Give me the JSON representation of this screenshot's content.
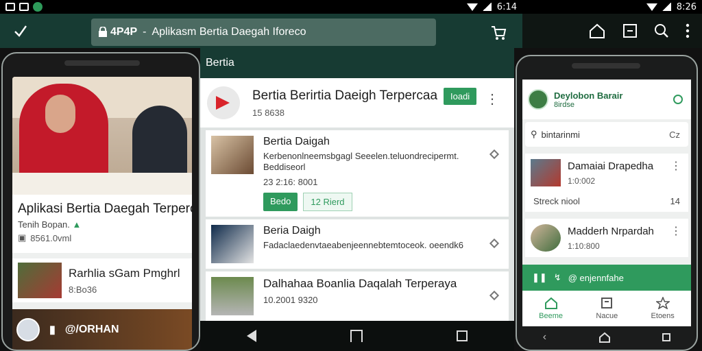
{
  "status": {
    "left_time": "6:14",
    "right_time": "8:26"
  },
  "topbar": {
    "url_tag": "4P4P",
    "url_text": "Aplikasm Bertia Daegah Iforeco"
  },
  "left_phone": {
    "headline": "Aplikasi Bertia Daegah Terperca",
    "source": "Tenih Bopan.",
    "meta": "8561.0vml",
    "card": {
      "title": "Rarhlia sGam Pmghrl",
      "meta": "8:Bo36"
    },
    "footer_label": "@/ORHAN"
  },
  "middle": {
    "section_title": "Bertia",
    "top_item": {
      "title": "Bertia Berirtia Daeigh Terpercaa",
      "sub": "15 8638",
      "badge": "Ioadi"
    },
    "cards": [
      {
        "title": "Bertia Daigah",
        "desc": "Kerbenonlneemsbgagl Seeelen.teluondrecipermt. Beddiseorl",
        "time": "23 2:16: 8001",
        "btn_primary": "Bedo",
        "btn_secondary": "12 Rierd"
      },
      {
        "title": "Beria Daigh",
        "desc": "Fadaclaedenvtaeabenjeennebtemtoceok. oeendk6",
        "time": ""
      },
      {
        "title": "Dalhahaa Boanlia Daqalah Terperaya",
        "desc": "",
        "time": "10.2001 9320"
      }
    ]
  },
  "right_phone": {
    "profile": {
      "name": "Deylobon Barair",
      "sub": "8irdse"
    },
    "search_placeholder": "bintarinmi",
    "search_right": "Cz",
    "cards": [
      {
        "title": "Damaiai Drapedha",
        "meta": "1:0:002",
        "line_left": "Streck niool",
        "line_right": "14"
      },
      {
        "title": "Madderh Nrpardah",
        "meta": "1:10:800"
      }
    ],
    "action_text": "@ enjennfahe",
    "tabs": [
      {
        "label": "Beeme"
      },
      {
        "label": "Nacue"
      },
      {
        "label": "Etoens"
      }
    ]
  },
  "colors": {
    "brand_dark": "#173b33",
    "accent": "#2f9a5d",
    "alert": "#d9242b"
  }
}
